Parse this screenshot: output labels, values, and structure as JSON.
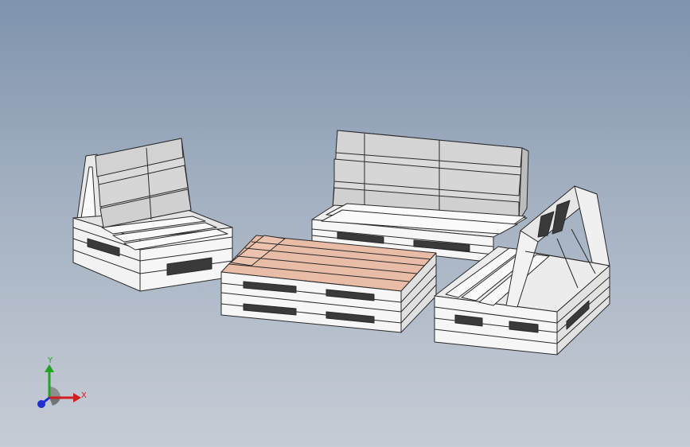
{
  "viewport": {
    "background_top": "#7f93ad",
    "background_bottom": "#c6ccd5"
  },
  "model": {
    "components": [
      "pallet-armchair-left",
      "pallet-sofa-center",
      "pallet-coffee-table",
      "pallet-armchair-right"
    ],
    "colors": {
      "pallet_face": "#f4f4f4",
      "pallet_top": "#dcdcdc",
      "pallet_edge": "#2a2a2a",
      "backrest_face": "#d9d9d9",
      "tabletop_wood": "#e6b9a3"
    }
  },
  "triad": {
    "x_label": "X",
    "y_label": "Y",
    "x_color": "#d11f1f",
    "y_color": "#1fa51f",
    "z_color": "#1f2fd1"
  }
}
